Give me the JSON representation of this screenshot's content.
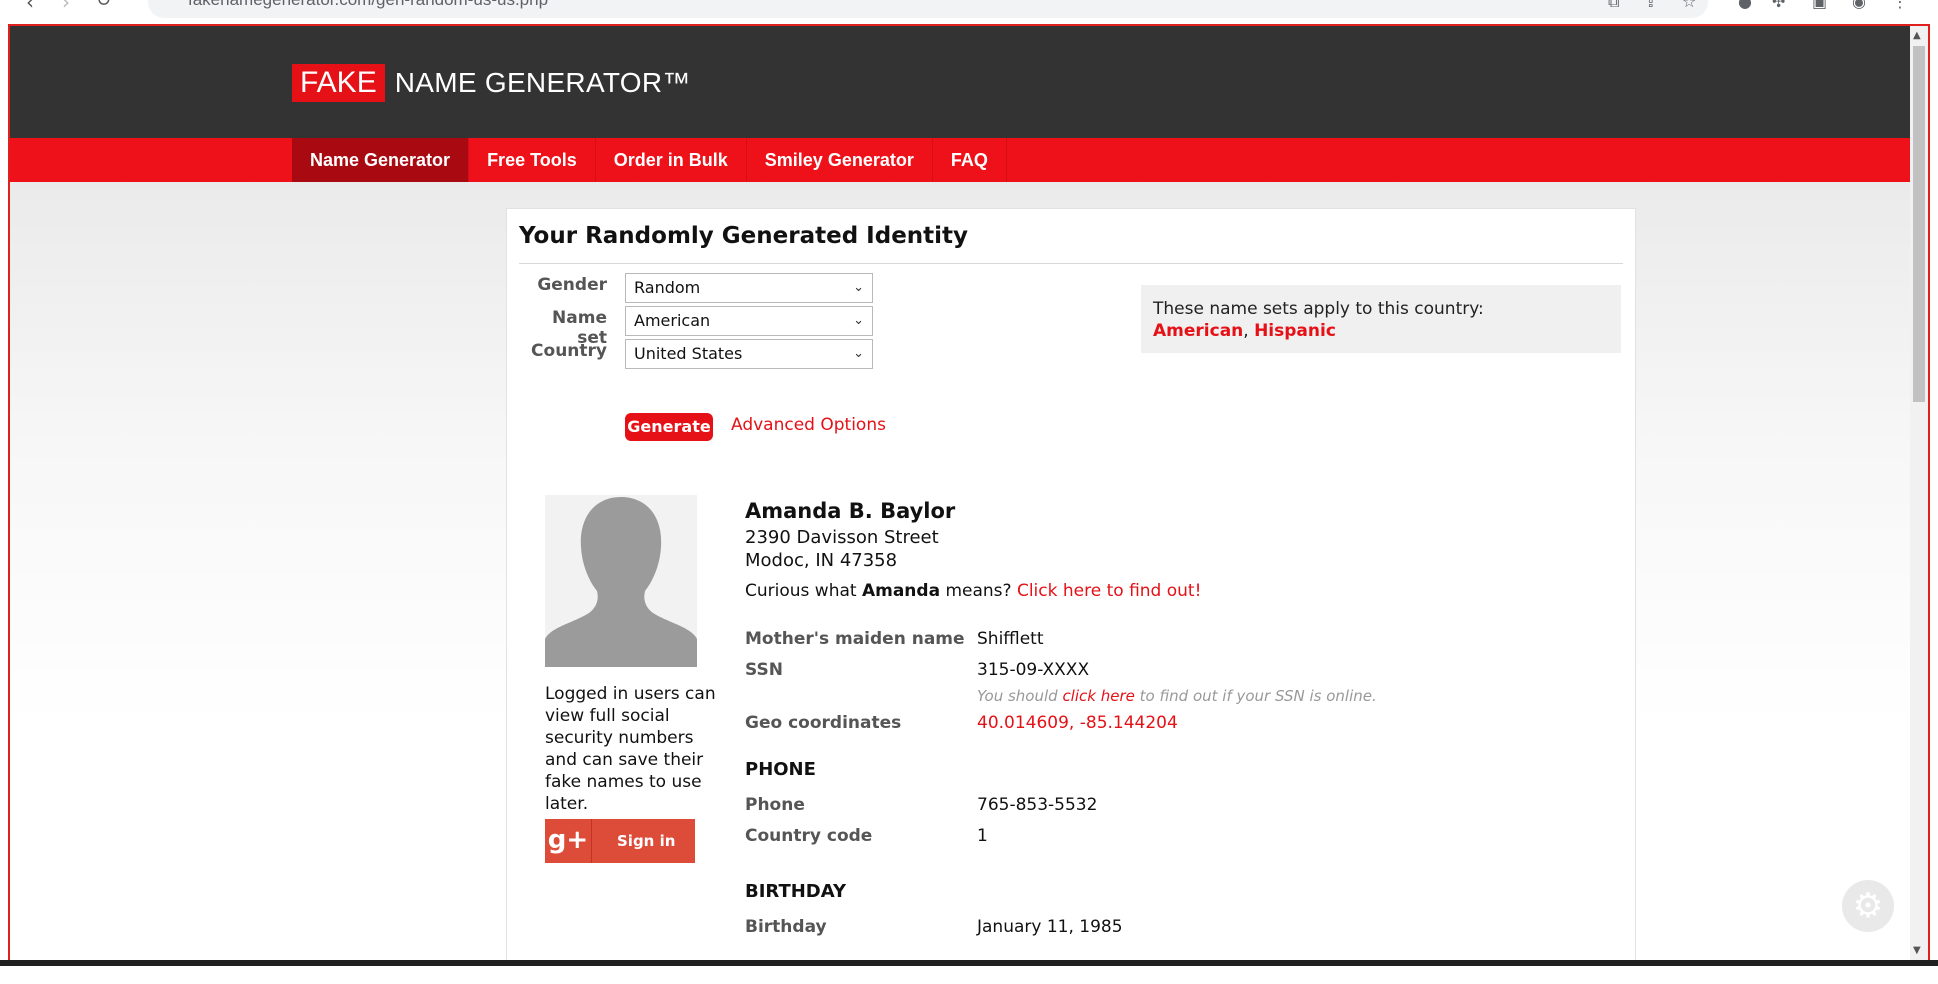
{
  "browser": {
    "url": "fakenamegenerator.com/gen-random-us-us.php"
  },
  "site": {
    "logo_fake": "FAKE",
    "logo_rest": "NAME GENERATOR™",
    "nav": [
      "Name Generator",
      "Free Tools",
      "Order in Bulk",
      "Smiley Generator",
      "FAQ"
    ]
  },
  "card": {
    "title": "Your Randomly Generated Identity",
    "form": {
      "gender_label": "Gender",
      "gender_value": "Random",
      "nameset_label": "Name set",
      "nameset_value": "American",
      "country_label": "Country",
      "country_value": "United States",
      "generate_label": "Generate",
      "advanced_label": "Advanced Options"
    },
    "name_sets": {
      "intro": "These name sets apply to this country:",
      "sets": [
        "American",
        "Hispanic"
      ],
      "separator": ", "
    },
    "sidebar": {
      "login_note": "Logged in users can view full social security numbers and can save their fake names to use later.",
      "gplus_glyph": "g+",
      "signin_label": "Sign in"
    },
    "identity": {
      "name": "Amanda B. Baylor",
      "address_line1": "2390 Davisson Street",
      "address_line2": "Modoc, IN 47358",
      "curious_prefix": "Curious what ",
      "curious_name": "Amanda",
      "curious_suffix": " means? ",
      "curious_link": "Click here to find out!",
      "maiden_label": "Mother's maiden name",
      "maiden_value": "Shifflett",
      "ssn_label": "SSN",
      "ssn_value": "315-09-XXXX",
      "ssn_note_prefix": "You should ",
      "ssn_note_link": "click here",
      "ssn_note_suffix": " to find out if your SSN is online.",
      "geo_label": "Geo coordinates",
      "geo_value": "40.014609, -85.144204",
      "phone_heading": "PHONE",
      "phone_label": "Phone",
      "phone_value": "765-853-5532",
      "cc_label": "Country code",
      "cc_value": "1",
      "birthday_heading": "BIRTHDAY",
      "birthday_label": "Birthday",
      "birthday_value": "January 11, 1985"
    }
  },
  "colors": {
    "brand_red": "#e51117",
    "header_dark": "#333333",
    "nav_active": "#a90910"
  }
}
